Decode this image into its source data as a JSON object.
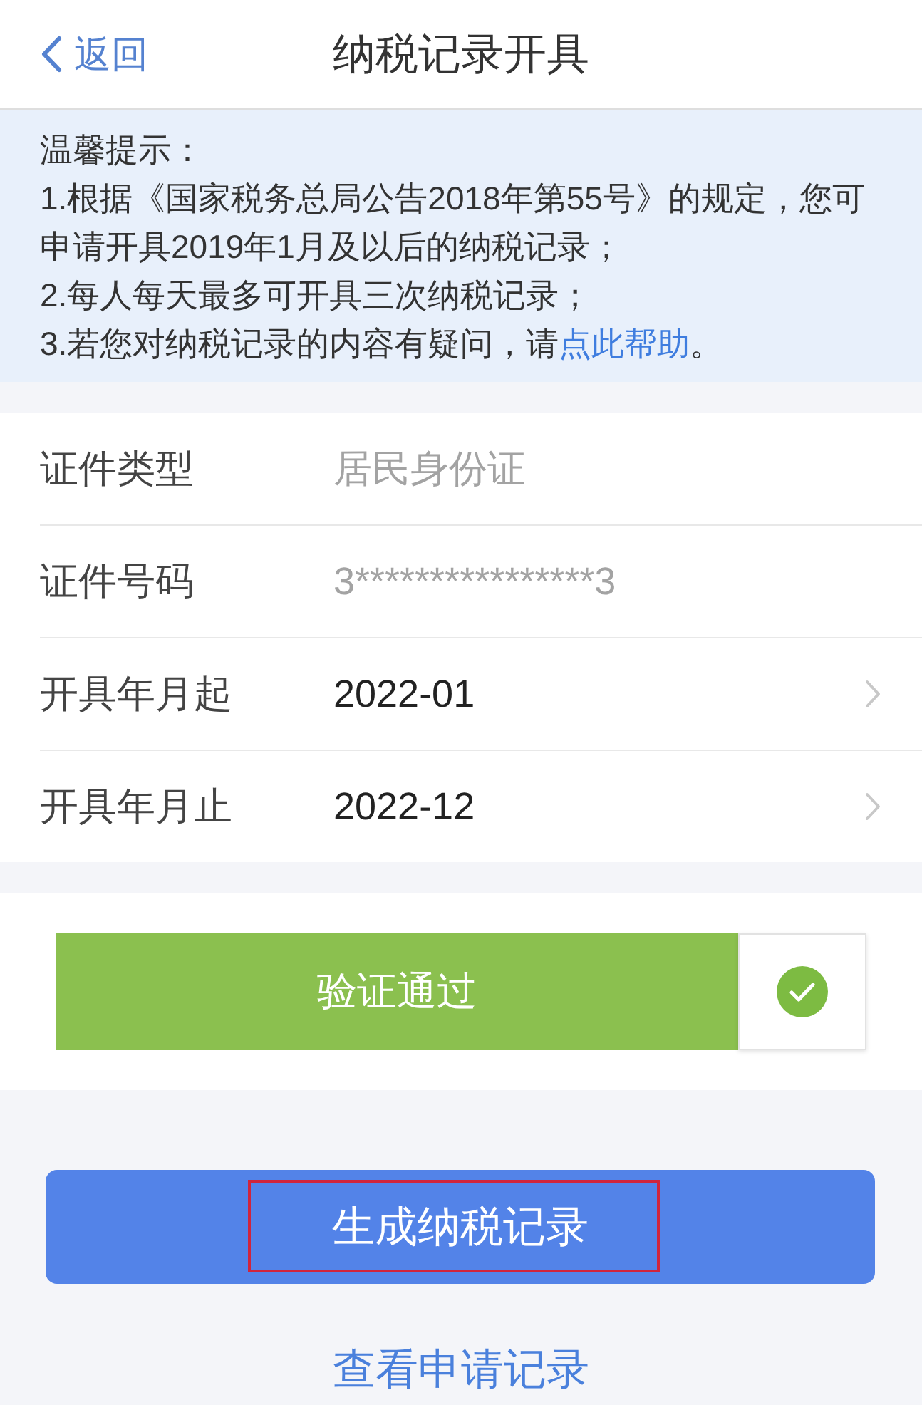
{
  "nav_bar": {
    "back": "返回",
    "title": "纳税记录开具"
  },
  "notice": {
    "title": "温馨提示：",
    "items": [
      {
        "text": "1.根据《国家税务总局公告2018年第55号》的规定，您可申请开具2019年1月及以后的纳税记录；"
      },
      {
        "text": "2.每人每天最多可开具三次纳税记录；"
      },
      {
        "text": "3.若您对纳税记录的内容有疑问，请",
        "link": "点此帮助",
        "tail": "。"
      }
    ]
  },
  "form": {
    "rows": [
      {
        "kind": "static",
        "label": "证件类型",
        "value": "居民身份证"
      },
      {
        "kind": "static",
        "label": "证件号码",
        "value": "3****************3"
      },
      {
        "kind": "picker",
        "label": "开具年月起",
        "value": "2022-01"
      },
      {
        "kind": "picker",
        "label": "开具年月止",
        "value": "2022-12"
      }
    ]
  },
  "verification": {
    "label": "验证通过",
    "passed": true
  },
  "generate_button": {
    "label": "生成纳税记录",
    "highlighted": true
  },
  "history_link": "查看申请记录"
}
